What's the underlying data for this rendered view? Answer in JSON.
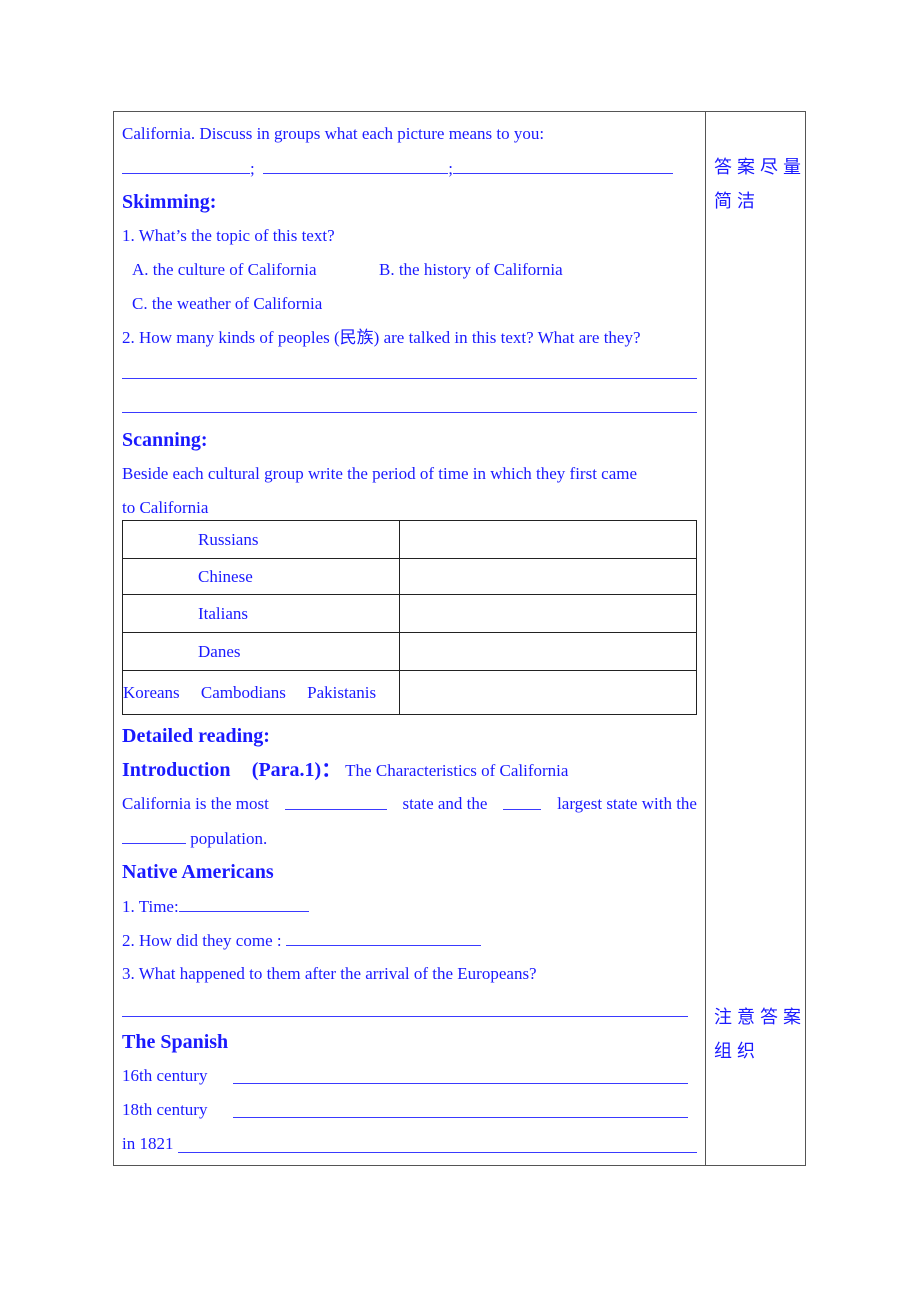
{
  "main": {
    "intro_line": "California. Discuss in groups what each picture means to you:",
    "blank_separator": ";",
    "skimming": {
      "heading": "Skimming:",
      "q1": "1. What’s the topic of this text?",
      "options": [
        "A. the culture of California",
        "B. the history of California",
        "C. the weather of California"
      ],
      "q2": "2. How many kinds of peoples (民族) are talked in this text? What are they?"
    },
    "scanning": {
      "heading": "Scanning:",
      "instruction_1": "Beside each cultural group write the period of time in which they first came",
      "instruction_2": "to California",
      "groups": [
        "Russians",
        "Chinese",
        "Italians",
        "Danes"
      ],
      "last_group": [
        "Koreans",
        "Cambodians",
        "Pakistanis"
      ],
      "periods": [
        "",
        "",
        "",
        "",
        ""
      ]
    },
    "detailed": {
      "heading": "Detailed reading:",
      "intro_heading": "Introduction",
      "intro_para": "(Para.1)：",
      "intro_title": "The Characteristics of California",
      "sentence_a": "California is the most",
      "sentence_b": "state and the",
      "sentence_c": "largest state with the",
      "sentence_d": "population.",
      "native": {
        "heading": "Native Americans",
        "q1": "1. Time:",
        "q2": "2. How did they come :",
        "q3": "3. What happened to them after the arrival of the Europeans?"
      },
      "spanish": {
        "heading": "The Spanish",
        "items": [
          "16th century",
          "18th century",
          "in 1821"
        ]
      }
    }
  },
  "side": {
    "note1_line1": "答案尽量",
    "note1_line2": "简洁",
    "note2_line1": "注意答案",
    "note2_line2": "组织"
  }
}
